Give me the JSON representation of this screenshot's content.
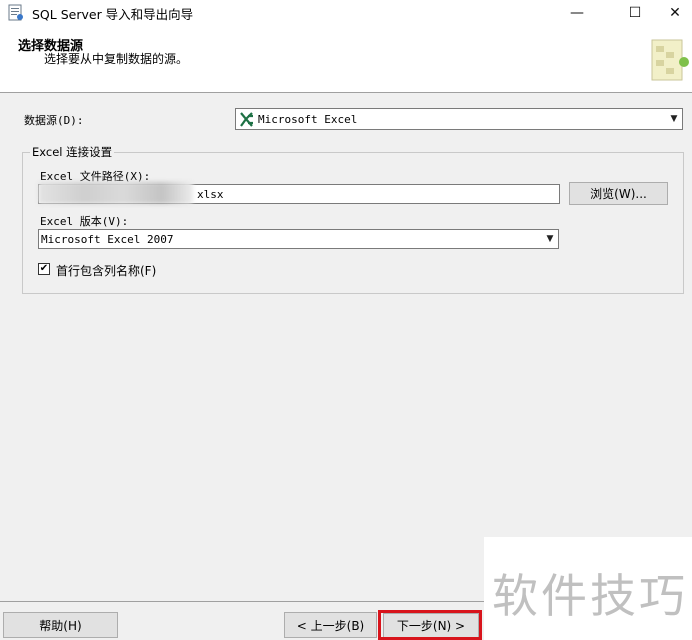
{
  "window": {
    "title": "SQL Server 导入和导出向导",
    "minimize_glyph": "—",
    "maximize_glyph": "☐",
    "close_glyph": "✕"
  },
  "header": {
    "title": "选择数据源",
    "subtitle": "选择要从中复制数据的源。"
  },
  "datasource": {
    "label": "数据源(D):",
    "value": "Microsoft Excel",
    "icon": "excel-icon"
  },
  "excel_settings": {
    "legend": "Excel 连接设置",
    "path_label": "Excel 文件路径(X):",
    "path_value": "xlsx",
    "browse_label": "浏览(W)...",
    "version_label": "Excel 版本(V):",
    "version_value": "Microsoft Excel 2007",
    "header_checkbox_label": "首行包含列名称(F)",
    "header_checkbox_checked": true
  },
  "footer": {
    "help_label": "帮助(H)",
    "back_label": "< 上一步(B)",
    "next_label": "下一步(N) >"
  },
  "watermark": {
    "text": "软件技巧"
  },
  "colors": {
    "highlight": "#d8141c",
    "excel_green": "#1e7145"
  }
}
